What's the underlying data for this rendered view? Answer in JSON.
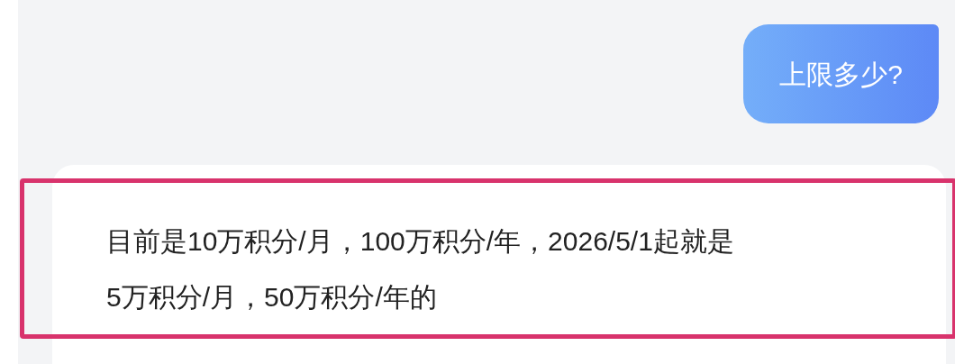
{
  "messages": [
    {
      "kind": "user",
      "text": "上限多少?"
    },
    {
      "kind": "bot",
      "text": "目前是10万积分/月，100万积分/年，2026/5/1起就是5万积分/月，50万积分/年的",
      "highlighted": true
    }
  ]
}
